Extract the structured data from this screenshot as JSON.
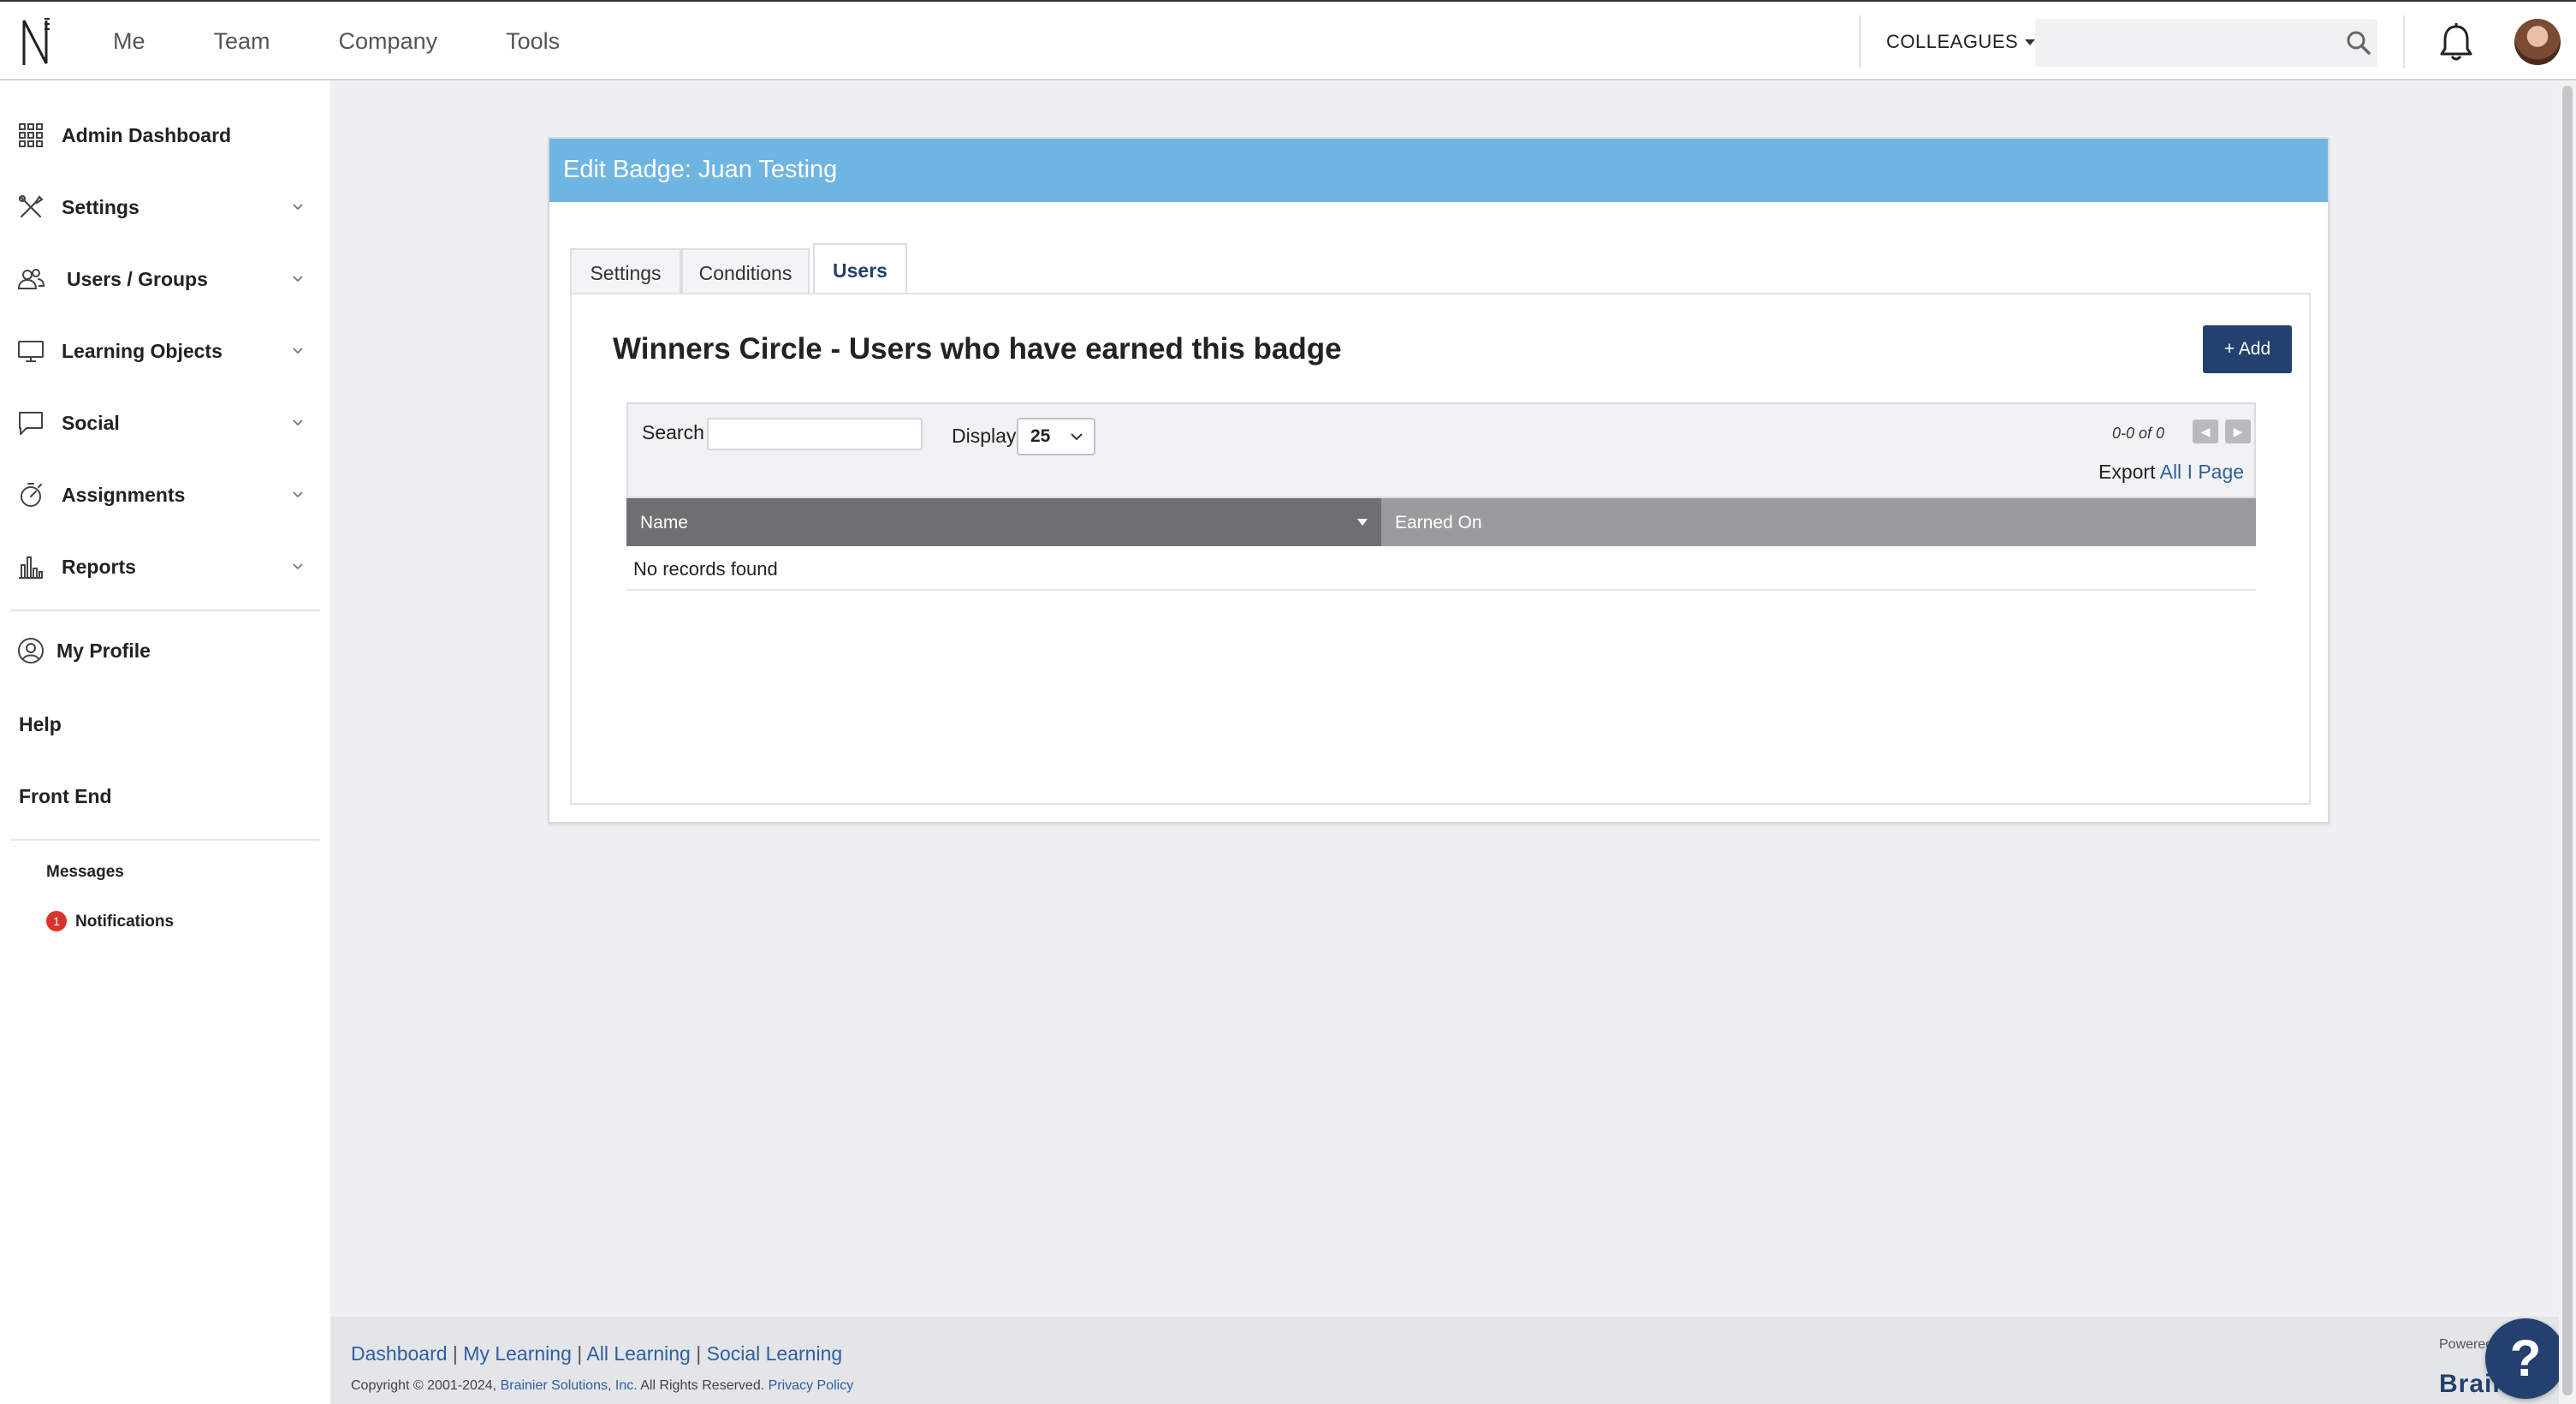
{
  "topbar": {
    "nav": [
      "Me",
      "Team",
      "Company",
      "Tools"
    ],
    "colleagues_label": "COLLEAGUES",
    "search_placeholder": ""
  },
  "sidebar": {
    "items": [
      {
        "label": "Admin Dashboard",
        "icon": "grid-icon",
        "expandable": false
      },
      {
        "label": "Settings",
        "icon": "tools-icon",
        "expandable": true
      },
      {
        "label": "Users / Groups",
        "icon": "users-icon",
        "expandable": true
      },
      {
        "label": "Learning Objects",
        "icon": "monitor-icon",
        "expandable": true
      },
      {
        "label": "Social",
        "icon": "chat-bubble-icon",
        "expandable": true
      },
      {
        "label": "Assignments",
        "icon": "stopwatch-icon",
        "expandable": true
      },
      {
        "label": "Reports",
        "icon": "bar-chart-icon",
        "expandable": true
      }
    ],
    "my_profile": "My Profile",
    "help": "Help",
    "front_end": "Front End",
    "messages": "Messages",
    "notifications": "Notifications",
    "notifications_count": "1"
  },
  "card": {
    "title": "Edit Badge: Juan Testing",
    "tabs": [
      "Settings",
      "Conditions",
      "Users"
    ],
    "active_tab": "Users",
    "panel_title": "Winners Circle - Users who have earned this badge",
    "add_label": "+ Add"
  },
  "grid": {
    "search_label": "Search",
    "search_value": "",
    "display_label": "Display",
    "display_value": "25",
    "pager_text": "0-0 of 0",
    "export_label": "Export",
    "export_all": "All",
    "export_sep": "I",
    "export_page": "Page",
    "columns": [
      "Name",
      "Earned On"
    ],
    "empty_text": "No records found"
  },
  "footer": {
    "links": [
      "Dashboard",
      "My Learning",
      "All Learning",
      "Social Learning"
    ],
    "copyright_prefix": "Copyright © 2001-2024,",
    "company": "Brainier Solutions, Inc.",
    "rights": "All Rights Reserved.",
    "privacy": "Privacy Policy",
    "powered": "Powered",
    "brand": "Brain"
  },
  "colors": {
    "header_blue": "#6fb5e2",
    "navy": "#23406e",
    "link": "#2f5f9e",
    "badge_red": "#d9342b"
  }
}
